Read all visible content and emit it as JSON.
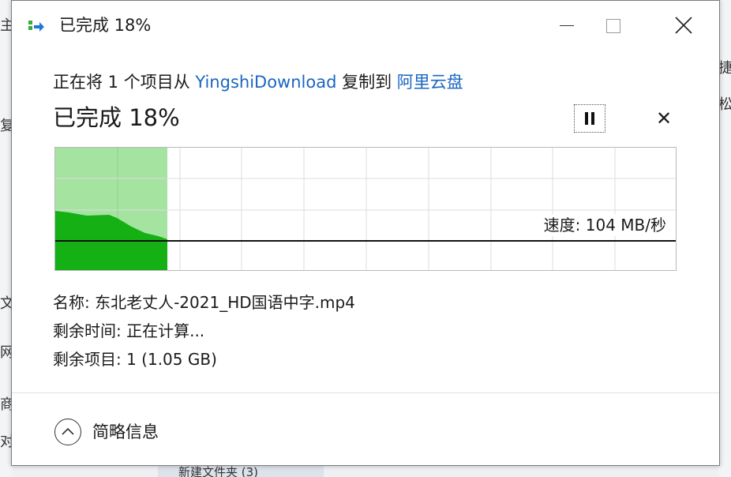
{
  "window": {
    "title": "已完成 18%"
  },
  "copy": {
    "prefix": "正在将 1 个项目从 ",
    "source": "YingshiDownload",
    "middle": " 复制到 ",
    "destination": "阿里云盘"
  },
  "progress": {
    "status": "已完成 18%",
    "percent": 18,
    "speed_label": "速度: 104 MB/秒"
  },
  "details": {
    "name": "名称: 东北老丈人-2021_HD国语中字.mp4",
    "time_remaining": "剩余时间: 正在计算...",
    "items_remaining": "剩余项目: 1 (1.05 GB)"
  },
  "footer": {
    "toggle_label": "简略信息"
  },
  "background": {
    "left_fragments": [
      "主",
      "复",
      "文",
      "网",
      "商",
      "对"
    ],
    "right_fragments": [
      "捷",
      "松"
    ],
    "bottom_text": "新建文件夹 (3)"
  },
  "colors": {
    "progress_fill": "#a4e3a0",
    "speed_fill": "#14b014",
    "link": "#1a66c2",
    "accent_icon": "#1e78d7"
  },
  "icons": {
    "copy": "copy-arrow-icon",
    "minimize": "minimize-icon",
    "maximize": "maximize-icon",
    "close": "close-icon",
    "pause": "pause-icon",
    "cancel": "cancel-icon",
    "collapse": "chevron-up-icon"
  }
}
